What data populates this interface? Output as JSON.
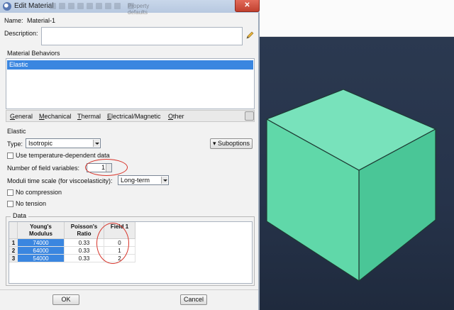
{
  "window": {
    "title": "Edit Material",
    "background_toolbar_text": "Property defaults"
  },
  "form": {
    "name_label": "Name:",
    "name_value": "Material-1",
    "description_label": "Description:",
    "description_value": ""
  },
  "behaviors": {
    "title": "Material Behaviors",
    "items": [
      "Elastic"
    ],
    "selected": "Elastic"
  },
  "menu": {
    "items": [
      {
        "label": "General",
        "mnemonic": "G"
      },
      {
        "label": "Mechanical",
        "mnemonic": "M"
      },
      {
        "label": "Thermal",
        "mnemonic": "T"
      },
      {
        "label": "Electrical/Magnetic",
        "mnemonic": "E"
      },
      {
        "label": "Other",
        "mnemonic": "O"
      }
    ]
  },
  "elastic": {
    "section_title": "Elastic",
    "type_label": "Type:",
    "type_value": "Isotropic",
    "suboptions_label": "Suboptions",
    "temp_dependent_label": "Use temperature-dependent data",
    "temp_dependent_checked": false,
    "field_vars_label": "Number of field variables:",
    "field_vars_value": "1",
    "time_scale_label": "Moduli time scale (for viscoelasticity):",
    "time_scale_value": "Long-term",
    "no_compression_label": "No compression",
    "no_compression_checked": false,
    "no_tension_label": "No tension",
    "no_tension_checked": false
  },
  "data_table": {
    "title": "Data",
    "columns": [
      "Young's Modulus",
      "Poisson's Ratio",
      "Field 1"
    ],
    "rows": [
      {
        "index": "1",
        "youngs": "74000",
        "poisson": "0.33",
        "field": "0"
      },
      {
        "index": "2",
        "youngs": "64000",
        "poisson": "0.33",
        "field": "1"
      },
      {
        "index": "3",
        "youngs": "54000",
        "poisson": "0.33",
        "field": "2"
      }
    ]
  },
  "buttons": {
    "ok": "OK",
    "cancel": "Cancel"
  },
  "colors": {
    "selection": "#3a86e0",
    "cube_front": "#5fd7a8",
    "cube_top": "#78e2bb",
    "cube_side": "#49c494",
    "viewport_bg": "#2b3950",
    "annotation_red": "#d8352b"
  }
}
